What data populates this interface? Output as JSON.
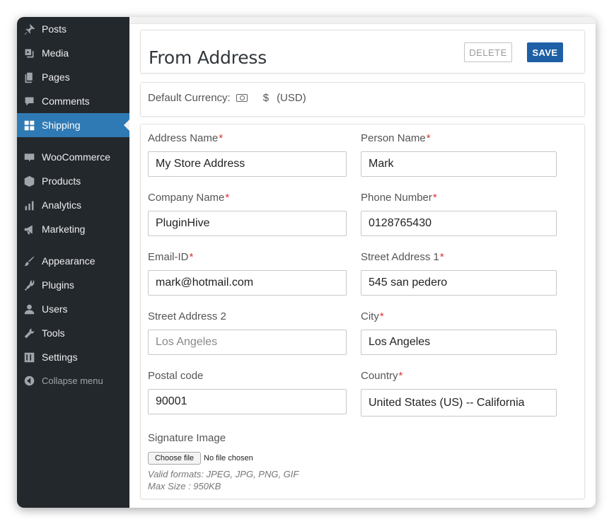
{
  "sidebar": {
    "items": [
      {
        "label": "Posts",
        "icon": "pushpin-icon"
      },
      {
        "label": "Media",
        "icon": "media-icon"
      },
      {
        "label": "Pages",
        "icon": "pages-icon"
      },
      {
        "label": "Comments",
        "icon": "comments-icon"
      },
      {
        "label": "Shipping",
        "icon": "grid-icon",
        "active": true
      },
      {
        "label": "WooCommerce",
        "icon": "woo-icon"
      },
      {
        "label": "Products",
        "icon": "box-icon"
      },
      {
        "label": "Analytics",
        "icon": "bar-chart-icon"
      },
      {
        "label": "Marketing",
        "icon": "megaphone-icon"
      },
      {
        "label": "Appearance",
        "icon": "brush-icon"
      },
      {
        "label": "Plugins",
        "icon": "plug-icon"
      },
      {
        "label": "Users",
        "icon": "user-icon"
      },
      {
        "label": "Tools",
        "icon": "wrench-icon"
      },
      {
        "label": "Settings",
        "icon": "sliders-icon"
      }
    ],
    "collapse_label": "Collapse menu",
    "active_color": "#2f7ab5",
    "bg_color": "#23282d"
  },
  "header": {
    "title": "From Address",
    "delete_label": "DELETE",
    "save_label": "SAVE",
    "save_color": "#1f5fa6"
  },
  "currency": {
    "label": "Default Currency:",
    "icon": "money-icon",
    "symbol": "$",
    "code": "(USD)"
  },
  "form": {
    "address_name": {
      "label": "Address Name",
      "required": "*",
      "value": "My Store Address"
    },
    "person_name": {
      "label": "Person Name",
      "required": "*",
      "value": "Mark"
    },
    "company_name": {
      "label": "Company Name",
      "required": "*",
      "value": "PluginHive"
    },
    "phone_number": {
      "label": "Phone Number",
      "required": "*",
      "value": "0128765430"
    },
    "email": {
      "label": "Email-ID",
      "required": "*",
      "value": "mark@hotmail.com"
    },
    "street1": {
      "label": "Street Address 1",
      "required": "*",
      "value": "545 san pedero"
    },
    "street2": {
      "label": "Street Address 2",
      "placeholder": "Los Angeles"
    },
    "city": {
      "label": "City",
      "required": "*",
      "value": "Los Angeles"
    },
    "postal": {
      "label": "Postal code",
      "value": "90001"
    },
    "country": {
      "label": "Country",
      "required": "*",
      "value": "United States (US) -- California"
    },
    "signature": {
      "label": "Signature Image",
      "button": "Choose file",
      "status": "No file chosen",
      "formats": "Valid formats: JPEG, JPG, PNG, GIF",
      "max_size": "Max Size : 950KB"
    }
  }
}
